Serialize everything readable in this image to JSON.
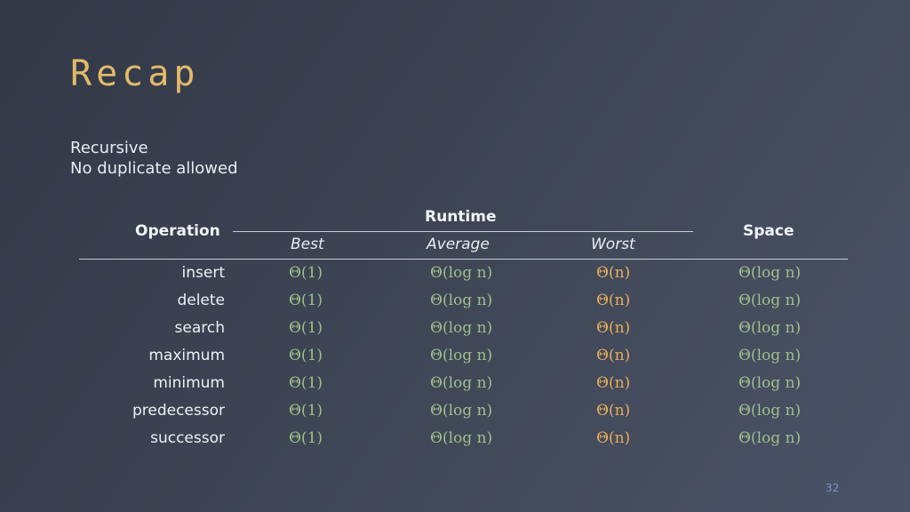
{
  "slide": {
    "title": "Recap",
    "subtitle_lines": [
      "Recursive",
      "No duplicate allowed"
    ],
    "page_number": "32"
  },
  "table": {
    "headers": {
      "operation": "Operation",
      "runtime": "Runtime",
      "space": "Space",
      "runtime_sub": [
        "Best",
        "Average",
        "Worst"
      ]
    },
    "rows": [
      {
        "operation": "insert",
        "best": "Θ(1)",
        "average": "Θ(log n)",
        "worst": "Θ(n)",
        "space": "Θ(log n)"
      },
      {
        "operation": "delete",
        "best": "Θ(1)",
        "average": "Θ(log n)",
        "worst": "Θ(n)",
        "space": "Θ(log n)"
      },
      {
        "operation": "search",
        "best": "Θ(1)",
        "average": "Θ(log n)",
        "worst": "Θ(n)",
        "space": "Θ(log n)"
      },
      {
        "operation": "maximum",
        "best": "Θ(1)",
        "average": "Θ(log n)",
        "worst": "Θ(n)",
        "space": "Θ(log n)"
      },
      {
        "operation": "minimum",
        "best": "Θ(1)",
        "average": "Θ(log n)",
        "worst": "Θ(n)",
        "space": "Θ(log n)"
      },
      {
        "operation": "predecessor",
        "best": "Θ(1)",
        "average": "Θ(log n)",
        "worst": "Θ(n)",
        "space": "Θ(log n)"
      },
      {
        "operation": "successor",
        "best": "Θ(1)",
        "average": "Θ(log n)",
        "worst": "Θ(n)",
        "space": "Θ(log n)"
      }
    ]
  },
  "colors": {
    "title": "#e2b96a",
    "complexity_green": "#9fbe8a",
    "complexity_orange": "#e7ad5b",
    "page_number": "#7b93c9"
  }
}
